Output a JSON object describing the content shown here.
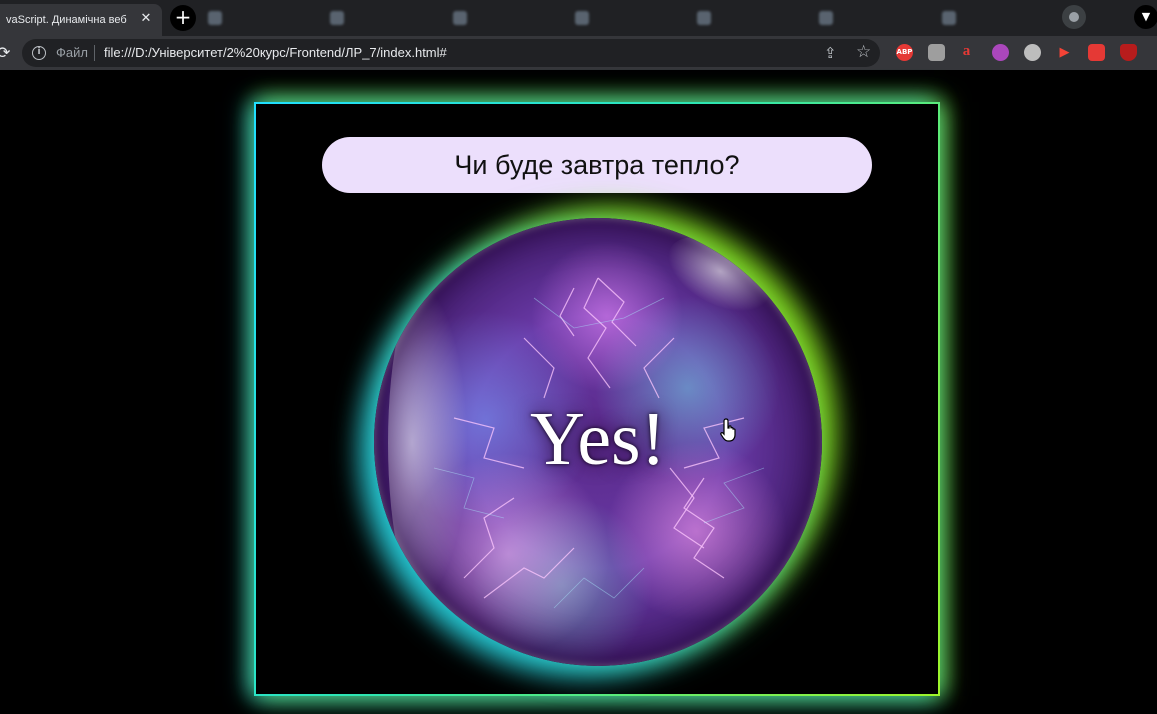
{
  "browser": {
    "active_tab_title": "vaScript. Динамічна веб",
    "background_tabs": [
      "",
      "",
      "",
      "",
      "",
      "",
      ""
    ],
    "site_info_label": "Файл",
    "url": "file:///D:/Університет/2%20курс/Frontend/ЛР_7/index.html#",
    "extensions": [
      "ABP",
      "",
      "a",
      "",
      "",
      "",
      "",
      ""
    ],
    "status_text": ""
  },
  "page": {
    "question": "Чи буде завтра тепло?",
    "answer": "Yes!"
  },
  "colors": {
    "page_background": "#000000",
    "frame_gradient_start": "#20dfff",
    "frame_gradient_end": "#9ef52a",
    "pill_background": "#ecdffc",
    "orb_core": "#5a2a8a"
  },
  "icons": {
    "tab_close": "close-icon",
    "new_tab": "plus-icon",
    "reload": "reload-icon",
    "site_info": "info-icon",
    "share": "share-icon",
    "bookmark": "star-icon",
    "cursor": "hand-pointer-icon"
  }
}
